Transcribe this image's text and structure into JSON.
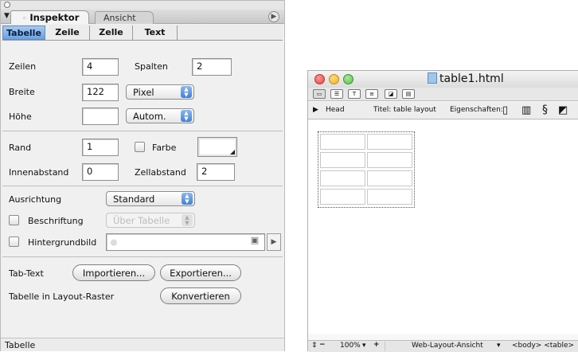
{
  "inspector": {
    "tabs": {
      "active": "Inspektor",
      "inactive": "Ansicht"
    },
    "subtabs": [
      "Tabelle",
      "Zeile",
      "Zelle",
      "Text"
    ],
    "active_subtab": "Tabelle",
    "rows_label": "Zeilen",
    "rows_value": "4",
    "cols_label": "Spalten",
    "cols_value": "2",
    "width_label": "Breite",
    "width_value": "122",
    "width_unit": "Pixel",
    "height_label": "Höhe",
    "height_value": "",
    "height_unit": "Autom.",
    "border_label": "Rand",
    "border_value": "1",
    "color_label": "Farbe",
    "padding_label": "Innenabstand",
    "padding_value": "0",
    "spacing_label": "Zellabstand",
    "spacing_value": "2",
    "align_label": "Ausrichtung",
    "align_value": "Standard",
    "caption_label": "Beschriftung",
    "caption_position": "Über Tabelle",
    "bgimage_label": "Hintergrundbild",
    "tabtext_label": "Tab-Text",
    "import_button": "Importieren...",
    "export_button": "Exportieren...",
    "layout_label": "Tabelle in Layout-Raster",
    "convert_button": "Konvertieren",
    "status": "Tabelle"
  },
  "document": {
    "title": "table1.html",
    "head_label": "Head",
    "title_field": "Titel: table layout",
    "props_label": "Eigenschaften:",
    "zoom": "100%",
    "view_mode": "Web-Layout-Ansicht",
    "tags": "<body> <table>"
  },
  "colors": {
    "accent": "#6aa2df",
    "close": "#e0443e",
    "minimize": "#f0b12b",
    "zoom": "#5cc14a"
  }
}
